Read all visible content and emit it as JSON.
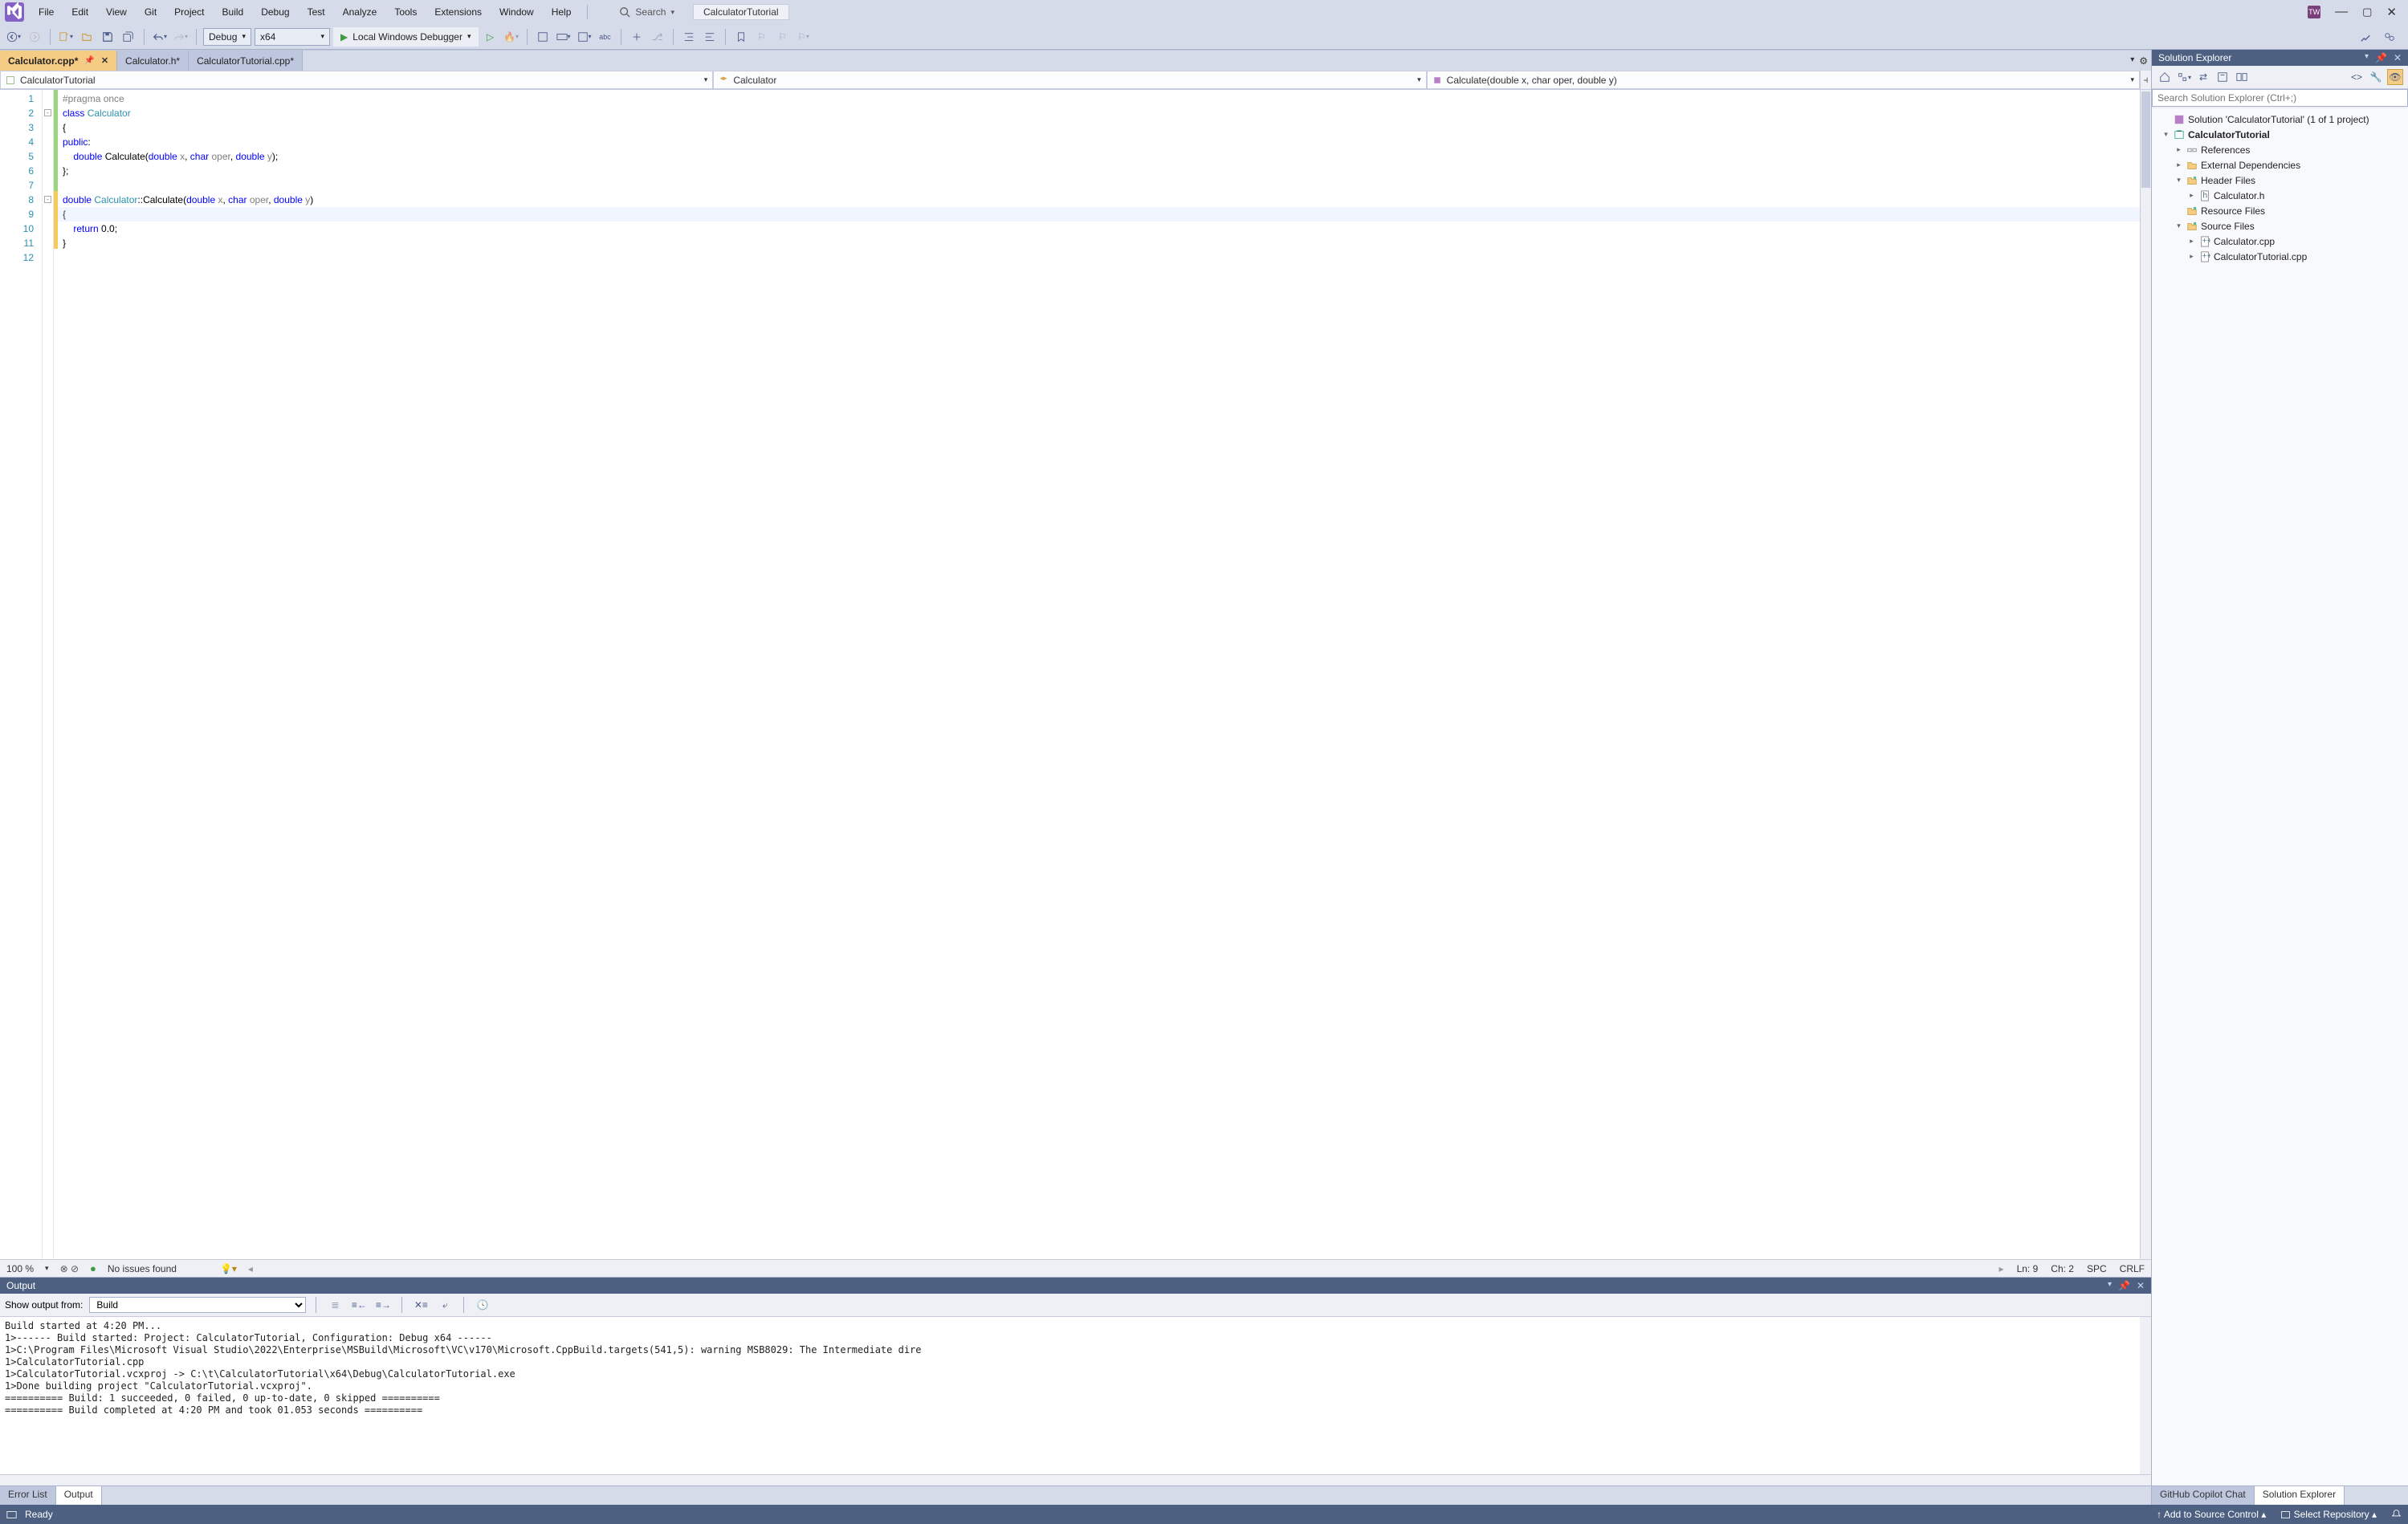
{
  "menu": {
    "items": [
      "File",
      "Edit",
      "View",
      "Git",
      "Project",
      "Build",
      "Debug",
      "Test",
      "Analyze",
      "Tools",
      "Extensions",
      "Window",
      "Help"
    ]
  },
  "search": {
    "label": "Search",
    "title": "CalculatorTutorial"
  },
  "toolbar": {
    "config": "Debug",
    "platform": "x64",
    "debugger_label": "Local Windows Debugger"
  },
  "tabs": [
    {
      "label": "Calculator.cpp*",
      "active": true,
      "pinned": true,
      "close": true
    },
    {
      "label": "Calculator.h*",
      "active": false
    },
    {
      "label": "CalculatorTutorial.cpp*",
      "active": false
    }
  ],
  "nav": {
    "scope": "CalculatorTutorial",
    "class": "Calculator",
    "member": "Calculate(double x, char oper, double y)"
  },
  "code": {
    "lines": [
      1,
      2,
      3,
      4,
      5,
      6,
      7,
      8,
      9,
      10,
      11,
      12
    ],
    "tokens": [
      [
        {
          "t": "#pragma once",
          "c": "pp"
        }
      ],
      [
        {
          "t": "class ",
          "c": "kw"
        },
        {
          "t": "Calculator",
          "c": "type"
        }
      ],
      [
        {
          "t": "{",
          "c": ""
        }
      ],
      [
        {
          "t": "public",
          "c": "kw"
        },
        {
          "t": ":",
          "c": ""
        }
      ],
      [
        {
          "t": "    ",
          "c": ""
        },
        {
          "t": "double ",
          "c": "kw"
        },
        {
          "t": "Calculate(",
          "c": ""
        },
        {
          "t": "double ",
          "c": "kw"
        },
        {
          "t": "x",
          "c": "param"
        },
        {
          "t": ", ",
          "c": ""
        },
        {
          "t": "char ",
          "c": "kw"
        },
        {
          "t": "oper",
          "c": "param"
        },
        {
          "t": ", ",
          "c": ""
        },
        {
          "t": "double ",
          "c": "kw"
        },
        {
          "t": "y",
          "c": "param"
        },
        {
          "t": ");",
          "c": ""
        }
      ],
      [
        {
          "t": "};",
          "c": ""
        }
      ],
      [
        {
          "t": "",
          "c": ""
        }
      ],
      [
        {
          "t": "double ",
          "c": "kw"
        },
        {
          "t": "Calculator",
          "c": "type"
        },
        {
          "t": "::Calculate(",
          "c": ""
        },
        {
          "t": "double ",
          "c": "kw"
        },
        {
          "t": "x",
          "c": "param"
        },
        {
          "t": ", ",
          "c": ""
        },
        {
          "t": "char ",
          "c": "kw"
        },
        {
          "t": "oper",
          "c": "param"
        },
        {
          "t": ", ",
          "c": ""
        },
        {
          "t": "double ",
          "c": "kw"
        },
        {
          "t": "y",
          "c": "param"
        },
        {
          "t": ")",
          "c": ""
        }
      ],
      [
        {
          "t": "{",
          "c": ""
        }
      ],
      [
        {
          "t": "    ",
          "c": ""
        },
        {
          "t": "return ",
          "c": "kw"
        },
        {
          "t": "0.0;",
          "c": ""
        }
      ],
      [
        {
          "t": "}",
          "c": ""
        }
      ],
      [
        {
          "t": "",
          "c": ""
        }
      ]
    ]
  },
  "editor_status": {
    "zoom": "100 %",
    "issues": "No issues found",
    "ln": "Ln: 9",
    "ch": "Ch: 2",
    "spc": "SPC",
    "crlf": "CRLF"
  },
  "output": {
    "panel_title": "Output",
    "from_label": "Show output from:",
    "from_value": "Build",
    "text": "Build started at 4:20 PM...\n1>------ Build started: Project: CalculatorTutorial, Configuration: Debug x64 ------\n1>C:\\Program Files\\Microsoft Visual Studio\\2022\\Enterprise\\MSBuild\\Microsoft\\VC\\v170\\Microsoft.CppBuild.targets(541,5): warning MSB8029: The Intermediate dire\n1>CalculatorTutorial.cpp\n1>CalculatorTutorial.vcxproj -> C:\\t\\CalculatorTutorial\\x64\\Debug\\CalculatorTutorial.exe\n1>Done building project \"CalculatorTutorial.vcxproj\".\n========== Build: 1 succeeded, 0 failed, 0 up-to-date, 0 skipped ==========\n========== Build completed at 4:20 PM and took 01.053 seconds =========="
  },
  "bottom_tabs_left": [
    {
      "label": "Error List",
      "active": false
    },
    {
      "label": "Output",
      "active": true
    }
  ],
  "bottom_tabs_right": [
    {
      "label": "GitHub Copilot Chat",
      "active": false
    },
    {
      "label": "Solution Explorer",
      "active": true
    }
  ],
  "solution_explorer": {
    "title": "Solution Explorer",
    "search_placeholder": "Search Solution Explorer (Ctrl+;)",
    "nodes": [
      {
        "depth": 0,
        "exp": "",
        "icon": "sln",
        "label": "Solution 'CalculatorTutorial' (1 of 1 project)"
      },
      {
        "depth": 0,
        "exp": "▾",
        "icon": "proj",
        "label": "CalculatorTutorial",
        "bold": true
      },
      {
        "depth": 1,
        "exp": "▸",
        "icon": "ref",
        "label": "References"
      },
      {
        "depth": 1,
        "exp": "▸",
        "icon": "folder",
        "label": "External Dependencies"
      },
      {
        "depth": 1,
        "exp": "▾",
        "icon": "filter",
        "label": "Header Files"
      },
      {
        "depth": 2,
        "exp": "▸",
        "icon": "h",
        "label": "Calculator.h"
      },
      {
        "depth": 1,
        "exp": "",
        "icon": "filter",
        "label": "Resource Files"
      },
      {
        "depth": 1,
        "exp": "▾",
        "icon": "filter",
        "label": "Source Files"
      },
      {
        "depth": 2,
        "exp": "▸",
        "icon": "cpp",
        "label": "Calculator.cpp"
      },
      {
        "depth": 2,
        "exp": "▸",
        "icon": "cpp",
        "label": "CalculatorTutorial.cpp"
      }
    ]
  },
  "statusbar": {
    "ready": "Ready",
    "add_source": "Add to Source Control",
    "select_repo": "Select Repository"
  }
}
